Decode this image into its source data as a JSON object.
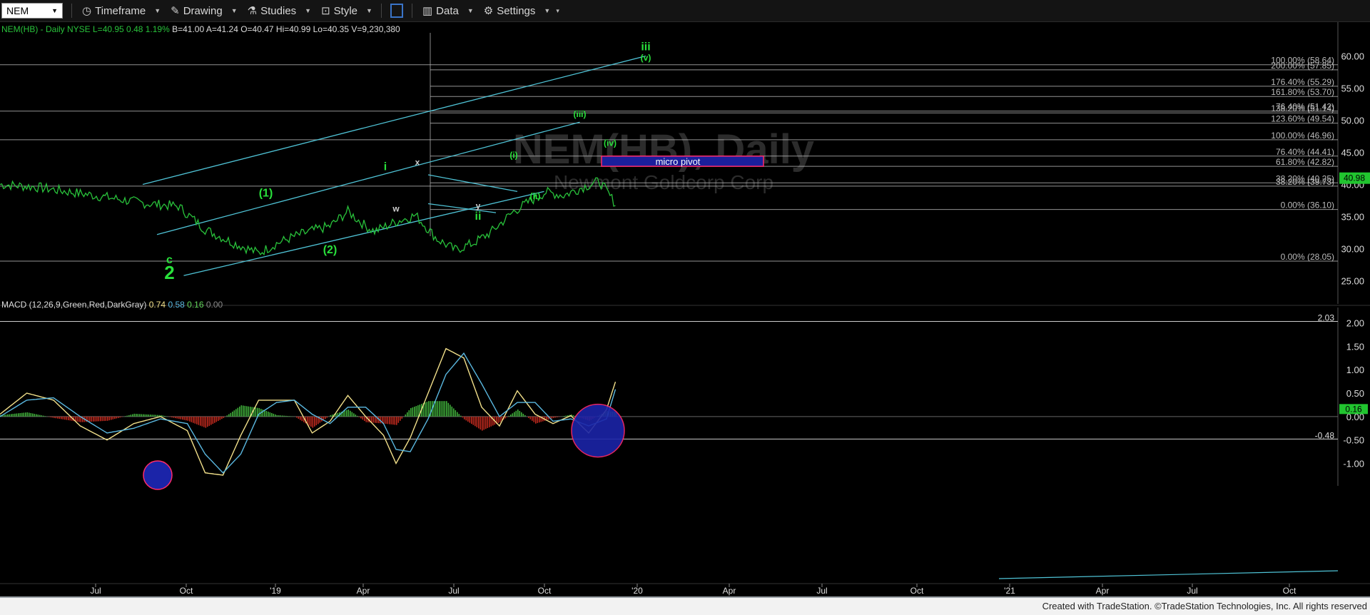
{
  "toolbar": {
    "symbol": "NEM",
    "items": [
      {
        "label": "Timeframe",
        "icon": "clock-icon"
      },
      {
        "label": "Drawing",
        "icon": "pencil-icon"
      },
      {
        "label": "Studies",
        "icon": "flask-icon"
      },
      {
        "label": "Style",
        "icon": "style-icon"
      },
      {
        "label": "Data",
        "icon": "bar-chart-icon"
      },
      {
        "label": "Settings",
        "icon": "gear-icon"
      }
    ]
  },
  "colors": {
    "price": "#29c23b",
    "channel": "#4fc3d6",
    "wave": "#29e03b",
    "fib": "#b8b8b8",
    "pivot_fill": "#1b1f9c",
    "pivot_border": "#ff2a6a",
    "up_hist": "#3fae3a",
    "down_hist": "#c02a1e",
    "macd": "#f2e08a",
    "signal": "#5ab8e0"
  },
  "chart_data": [
    {
      "type": "line",
      "header": {
        "symbol": "NEM(HB)",
        "interval": "Daily",
        "exchange": "NYSE",
        "last": "L=40.95",
        "change": "0.48",
        "pct": "1.19%",
        "bid": "B=41.00",
        "ask": "A=41.24",
        "open": "O=40.47",
        "high": "Hi=40.99",
        "low": "Lo=40.35",
        "volume": "V=9,230,380"
      },
      "watermark": "NEM(HB), Daily",
      "watermark_sub": "Newmont Goldcorp Corp",
      "x_ticks": [
        "Jul",
        "Oct",
        "'19",
        "Apr",
        "Jul",
        "Oct",
        "'20",
        "Apr",
        "Jul",
        "Oct",
        "'21",
        "Apr",
        "Jul",
        "Oct"
      ],
      "y_ticks": [
        "60.00",
        "55.00",
        "50.00",
        "45.00",
        "40.00",
        "35.00",
        "30.00",
        "25.00"
      ],
      "ylim": [
        22.5,
        62.5
      ],
      "last_price_label": "40.98",
      "series": [
        {
          "x": [
            0,
            20,
            40,
            60,
            80,
            100,
            115,
            130,
            145,
            155,
            165,
            175,
            185,
            195,
            205,
            210,
            222,
            233,
            245,
            255,
            265,
            275,
            288,
            296,
            306,
            316,
            326,
            336,
            345
          ],
          "values": [
            40.0,
            39.6,
            38.8,
            38.0,
            37.1,
            36.6,
            33.0,
            31.0,
            29.3,
            30.8,
            31.9,
            32.8,
            33.5,
            35.8,
            33.5,
            32.7,
            34.2,
            35.2,
            31.5,
            29.8,
            30.8,
            32.5,
            35.8,
            37.2,
            38.8,
            38.3,
            39.5,
            40.5,
            37.0
          ]
        }
      ]
    },
    {
      "type": "line",
      "title": "MACD (12,26,9,Green,Red,DarkGray)",
      "values_text": [
        "0.74",
        "0.58",
        "0.16",
        "0.00"
      ],
      "y_ticks": [
        "2.00",
        "1.50",
        "1.00",
        "0.50",
        "0.00",
        "-0.50",
        "-1.00"
      ],
      "level_labels": [
        "2.03",
        "-0.48"
      ],
      "last_label": "0.16",
      "ylim": [
        -1.25,
        2.25
      ],
      "x": [
        0,
        15,
        30,
        45,
        60,
        75,
        90,
        105,
        115,
        125,
        135,
        145,
        155,
        165,
        175,
        185,
        195,
        205,
        215,
        222,
        230,
        240,
        250,
        260,
        270,
        280,
        290,
        300,
        310,
        320,
        330,
        340,
        345
      ],
      "series": [
        {
          "name": "MACD",
          "values": [
            0.05,
            0.5,
            0.35,
            -0.2,
            -0.5,
            -0.15,
            0.0,
            -0.3,
            -1.2,
            -1.25,
            -0.4,
            0.35,
            0.35,
            0.35,
            -0.35,
            -0.1,
            0.45,
            0.0,
            -0.4,
            -1.0,
            -0.45,
            0.5,
            1.45,
            1.25,
            0.2,
            -0.2,
            0.55,
            0.05,
            -0.15,
            0.02,
            -0.35,
            0.15,
            0.74
          ]
        },
        {
          "name": "Signal",
          "values": [
            0.0,
            0.35,
            0.4,
            0.0,
            -0.35,
            -0.25,
            -0.05,
            -0.15,
            -0.8,
            -1.2,
            -0.8,
            0.05,
            0.3,
            0.35,
            0.05,
            -0.15,
            0.2,
            0.2,
            -0.15,
            -0.7,
            -0.75,
            -0.05,
            0.9,
            1.35,
            0.7,
            0.0,
            0.3,
            0.3,
            -0.1,
            -0.05,
            -0.2,
            -0.05,
            0.58
          ]
        }
      ]
    }
  ],
  "annotations": {
    "fib_levels": [
      {
        "label": "100.00% (58.64)",
        "value": 58.64
      },
      {
        "label": "200.00% (57.85)",
        "value": 57.85
      },
      {
        "label": "176.40% (55.29)",
        "value": 55.29
      },
      {
        "label": "161.80% (53.70)",
        "value": 53.7
      },
      {
        "label": "76.40% (51.42)",
        "value": 51.42
      },
      {
        "label": "138.20% (51.14)",
        "value": 51.14
      },
      {
        "label": "123.60% (49.54)",
        "value": 49.54
      },
      {
        "label": "100.00% (46.96)",
        "value": 46.96
      },
      {
        "label": "76.40% (44.41)",
        "value": 44.41
      },
      {
        "label": "61.80% (42.82)",
        "value": 42.82
      },
      {
        "label": "38.20% (40.25)",
        "value": 40.25
      },
      {
        "label": "38.20% (39.73)",
        "value": 39.73
      },
      {
        "label": "0.00% (36.10)",
        "value": 36.1
      },
      {
        "label": "0.00% (28.05)",
        "value": 28.05
      }
    ],
    "pivot_label": "micro pivot",
    "pivot_range": [
      42.82,
      44.41
    ],
    "wave_labels": [
      {
        "text": "iii",
        "x": 362,
        "value": 60.9
      },
      {
        "text": "(v)",
        "x": 362,
        "value": 59.3
      },
      {
        "text": "(iii)",
        "x": 325,
        "value": 50.5
      },
      {
        "text": "(iv)",
        "x": 342,
        "value": 46.0
      },
      {
        "text": "(i)",
        "x": 288,
        "value": 44.1
      },
      {
        "text": "(ii)",
        "x": 300,
        "value": 37.7
      },
      {
        "text": "i",
        "x": 216,
        "value": 42.2
      },
      {
        "text": "x",
        "x": 234,
        "value": 43.0
      },
      {
        "text": "w",
        "x": 222,
        "value": 35.8
      },
      {
        "text": "y",
        "x": 268,
        "value": 36.2
      },
      {
        "text": "ii",
        "x": 268,
        "value": 34.5
      },
      {
        "text": "(1)",
        "x": 149,
        "value": 38.1
      },
      {
        "text": "(2)",
        "x": 185,
        "value": 29.3
      },
      {
        "text": "c",
        "x": 95,
        "value": 27.7
      },
      {
        "text": "2",
        "x": 95,
        "value": 25.3
      }
    ]
  },
  "footer": {
    "text": "Created with TradeStation. ©TradeStation Technologies, Inc. All rights reserved"
  }
}
